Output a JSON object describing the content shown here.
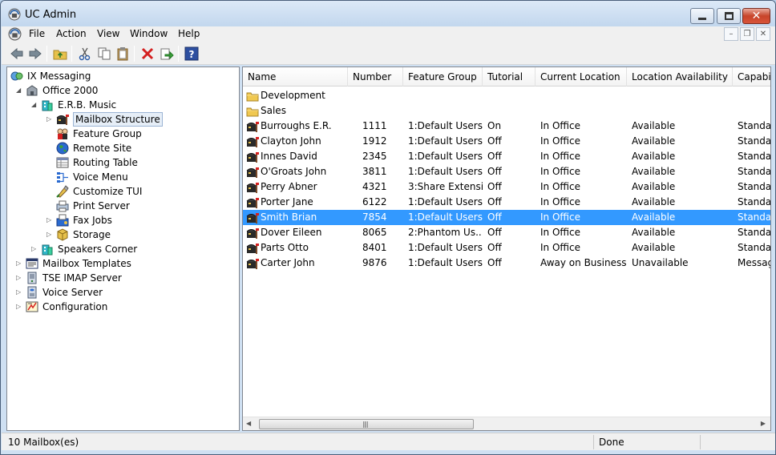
{
  "window": {
    "title": "UC Admin"
  },
  "menu": [
    "File",
    "Action",
    "View",
    "Window",
    "Help"
  ],
  "tree": [
    {
      "label": "IX Messaging",
      "level": 0,
      "expander": "",
      "icon": "ix-messaging-icon"
    },
    {
      "label": "Office 2000",
      "level": 1,
      "expander": "open",
      "icon": "office-icon"
    },
    {
      "label": "E.R.B. Music",
      "level": 2,
      "expander": "open",
      "icon": "company-icon"
    },
    {
      "label": "Mailbox Structure",
      "level": 3,
      "expander": "closed",
      "icon": "mailbox-icon",
      "selected": true
    },
    {
      "label": "Feature Group",
      "level": 3,
      "expander": "",
      "icon": "feature-group-icon"
    },
    {
      "label": "Remote Site",
      "level": 3,
      "expander": "",
      "icon": "globe-icon"
    },
    {
      "label": "Routing Table",
      "level": 3,
      "expander": "",
      "icon": "table-icon"
    },
    {
      "label": "Voice Menu",
      "level": 3,
      "expander": "",
      "icon": "voice-menu-icon"
    },
    {
      "label": "Customize TUI",
      "level": 3,
      "expander": "",
      "icon": "customize-icon"
    },
    {
      "label": "Print Server",
      "level": 3,
      "expander": "",
      "icon": "printer-icon"
    },
    {
      "label": "Fax Jobs",
      "level": 3,
      "expander": "closed",
      "icon": "fax-icon"
    },
    {
      "label": "Storage",
      "level": 3,
      "expander": "closed",
      "icon": "storage-icon"
    },
    {
      "label": "Speakers Corner",
      "level": 2,
      "expander": "closed",
      "icon": "company-icon"
    },
    {
      "label": "Mailbox Templates",
      "level": 1,
      "expander": "closed",
      "icon": "templates-icon"
    },
    {
      "label": "TSE IMAP Server",
      "level": 1,
      "expander": "closed",
      "icon": "server-icon"
    },
    {
      "label": "Voice Server",
      "level": 1,
      "expander": "closed",
      "icon": "voice-server-icon"
    },
    {
      "label": "Configuration",
      "level": 1,
      "expander": "closed",
      "icon": "configuration-icon"
    }
  ],
  "list": {
    "columns": [
      "Name",
      "Number",
      "Feature Group",
      "Tutorial",
      "Current Location",
      "Location Availability",
      "Capabil"
    ],
    "folders": [
      "Development",
      "Sales"
    ],
    "rows": [
      {
        "name": "Burroughs E.R.",
        "number": "1111",
        "feature_group": "1:Default Users",
        "tutorial": "On",
        "location": "In Office",
        "availability": "Available",
        "capability": "Standar"
      },
      {
        "name": "Clayton John",
        "number": "1912",
        "feature_group": "1:Default Users",
        "tutorial": "Off",
        "location": "In Office",
        "availability": "Available",
        "capability": "Standar"
      },
      {
        "name": "Innes David",
        "number": "2345",
        "feature_group": "1:Default Users",
        "tutorial": "Off",
        "location": "In Office",
        "availability": "Available",
        "capability": "Standar"
      },
      {
        "name": "O'Groats John",
        "number": "3811",
        "feature_group": "1:Default Users",
        "tutorial": "Off",
        "location": "In Office",
        "availability": "Available",
        "capability": "Standar"
      },
      {
        "name": "Perry Abner",
        "number": "4321",
        "feature_group": "3:Share Extensi...",
        "tutorial": "Off",
        "location": "In Office",
        "availability": "Available",
        "capability": "Standar"
      },
      {
        "name": "Porter Jane",
        "number": "6122",
        "feature_group": "1:Default Users",
        "tutorial": "Off",
        "location": "In Office",
        "availability": "Available",
        "capability": "Standar"
      },
      {
        "name": "Smith Brian",
        "number": "7854",
        "feature_group": "1:Default Users",
        "tutorial": "Off",
        "location": "In Office",
        "availability": "Available",
        "capability": "Standar",
        "selected": true
      },
      {
        "name": "Dover Eileen",
        "number": "8065",
        "feature_group": "2:Phantom Us...",
        "tutorial": "Off",
        "location": "In Office",
        "availability": "Available",
        "capability": "Standar"
      },
      {
        "name": "Parts Otto",
        "number": "8401",
        "feature_group": "1:Default Users",
        "tutorial": "Off",
        "location": "In Office",
        "availability": "Available",
        "capability": "Standar"
      },
      {
        "name": "Carter John",
        "number": "9876",
        "feature_group": "1:Default Users",
        "tutorial": "Off",
        "location": "Away on Business",
        "availability": "Unavailable",
        "capability": "Messag"
      }
    ]
  },
  "status": {
    "left": "10 Mailbox(es)",
    "right": "Done"
  },
  "colors": {
    "selection": "#3399ff",
    "titlebar": "#c2d7ee",
    "close_button": "#c7442a"
  }
}
